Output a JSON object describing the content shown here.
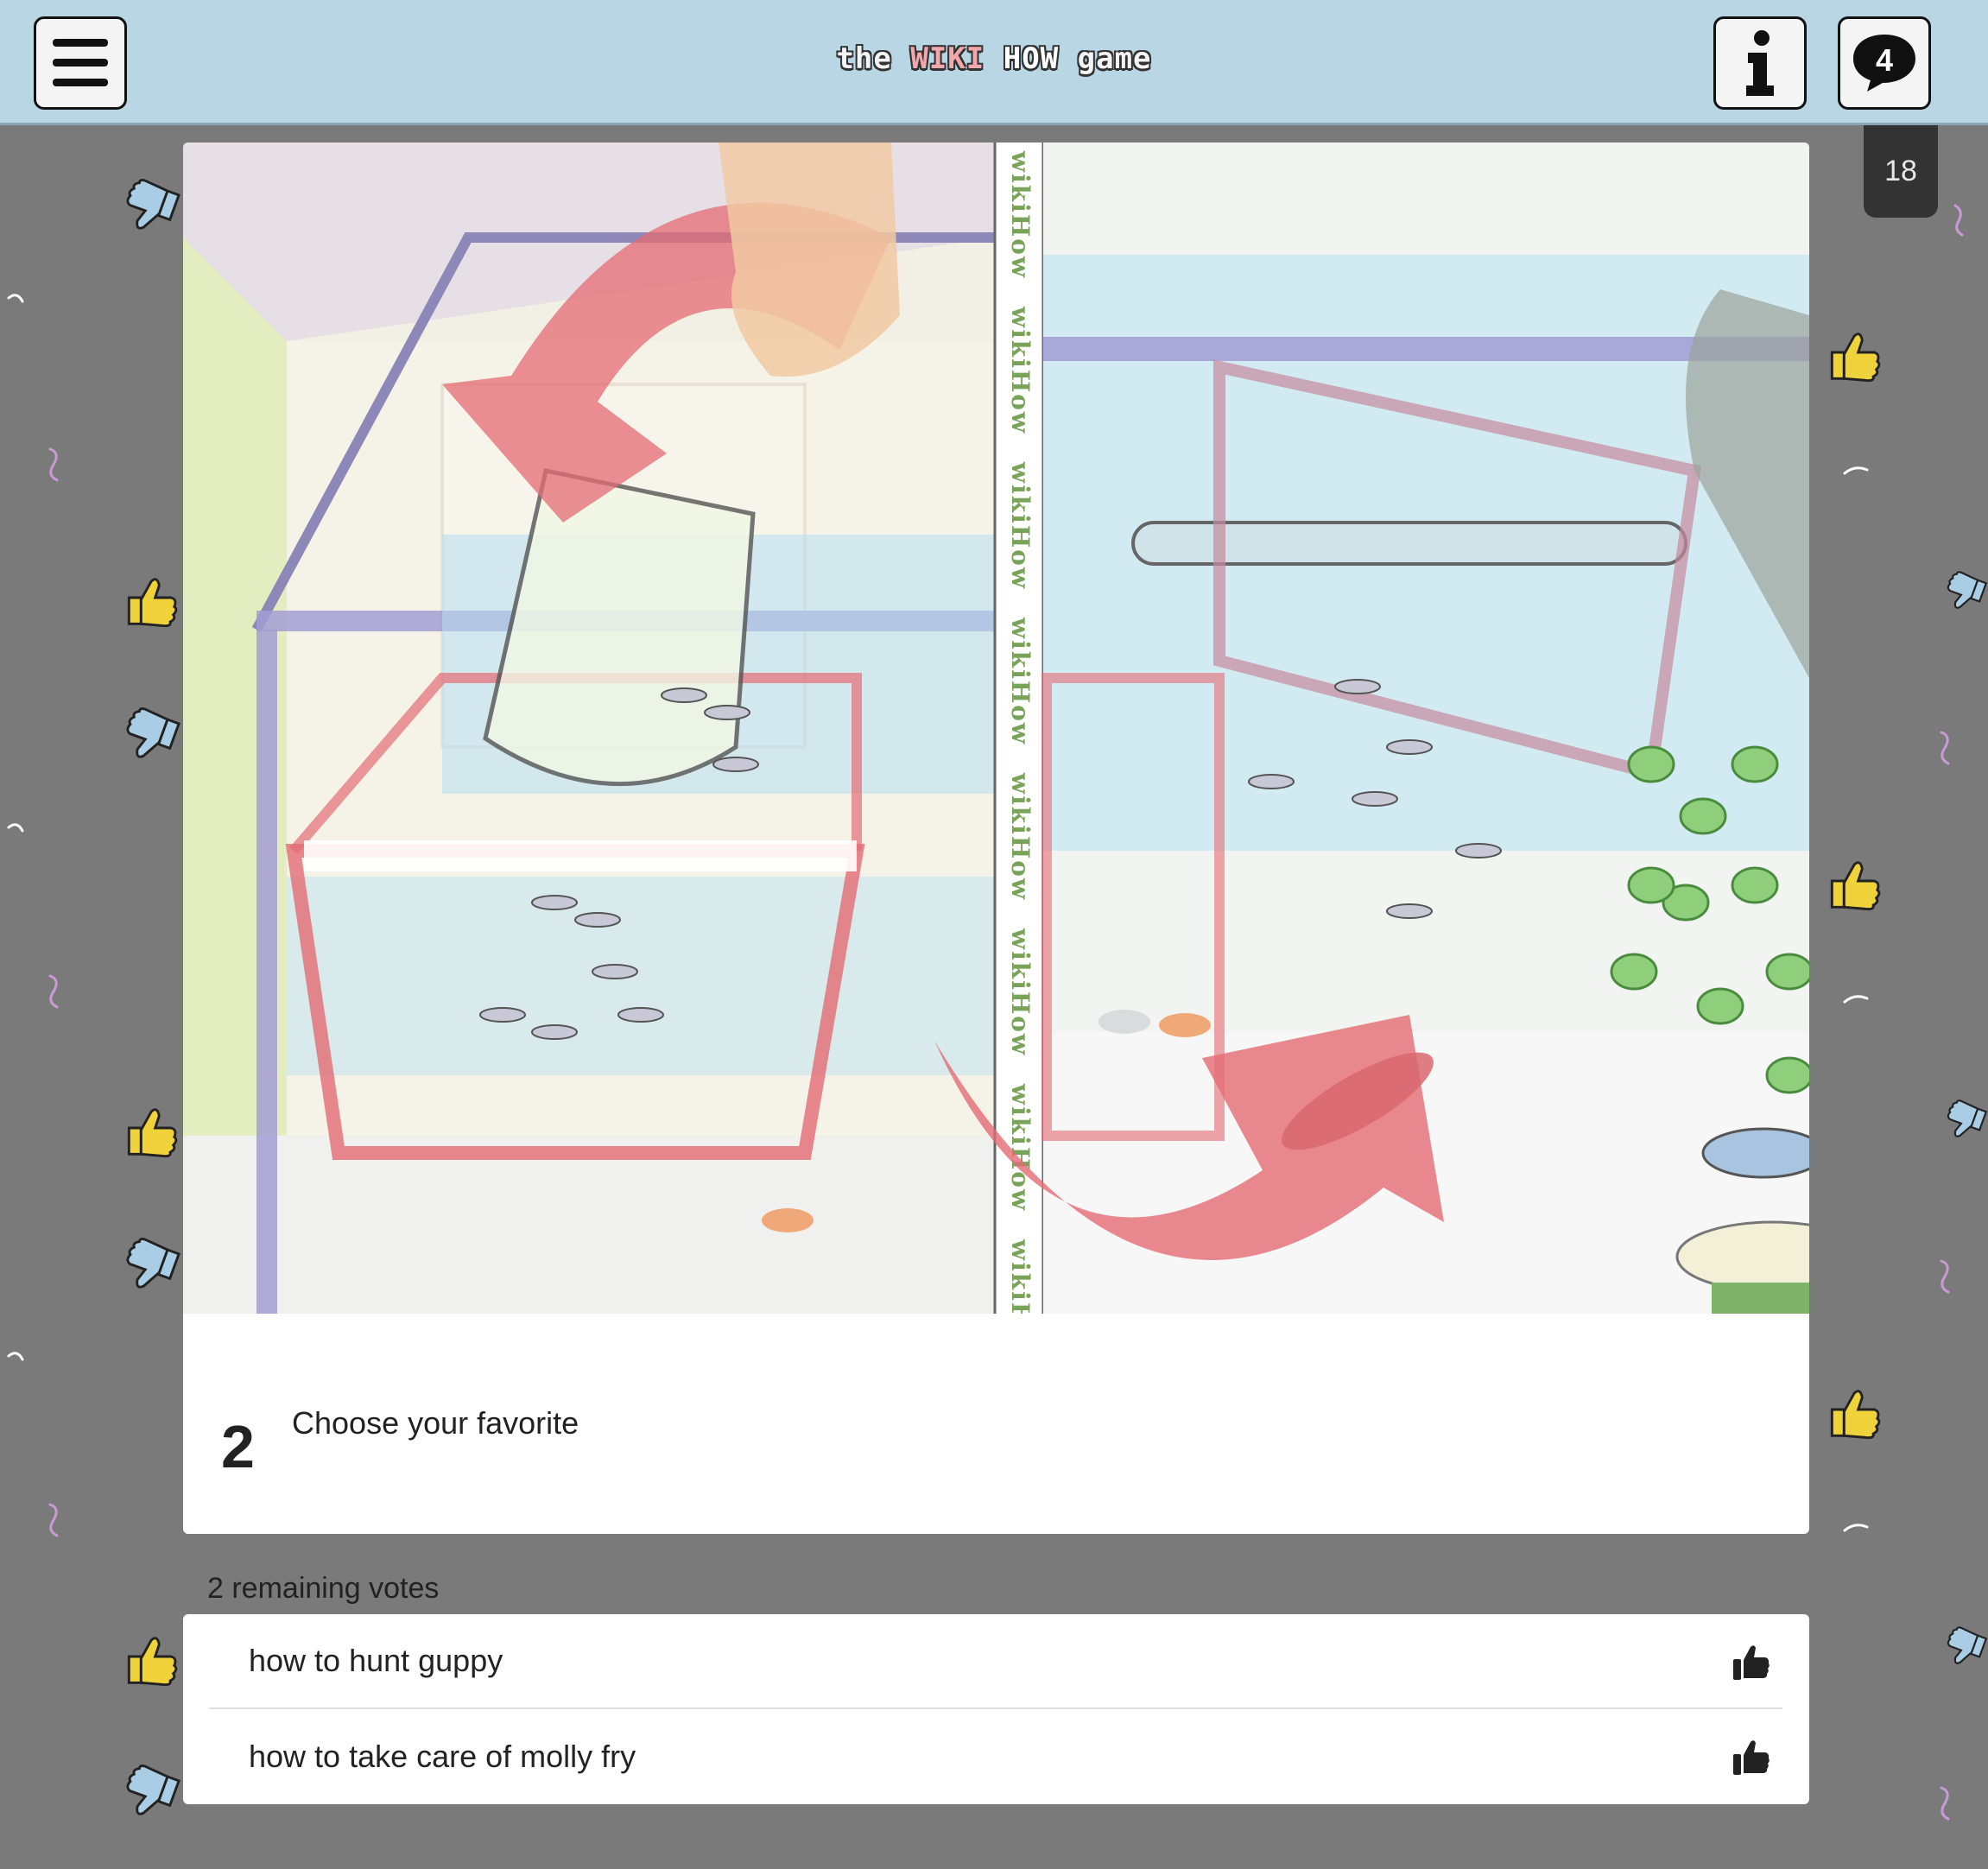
{
  "header": {
    "logo_the": "the",
    "logo_wiki": "WIKI",
    "logo_how": "HOW",
    "logo_game": "game",
    "menu_icon": "hamburger-menu-icon",
    "info_icon": "info-icon",
    "chat_icon": "chat-bubble-icon",
    "chat_count": "4"
  },
  "timer": {
    "value": "18"
  },
  "card": {
    "image_watermark": "wikiHow",
    "step_number": "2",
    "step_text": "Choose your favorite"
  },
  "votes": {
    "remaining_text": "2 remaining votes",
    "options": [
      {
        "label": "how to hunt guppy",
        "icon": "thumbs-up-icon"
      },
      {
        "label": "how to take care of molly fry",
        "icon": "thumbs-up-icon"
      }
    ]
  },
  "colors": {
    "header_bg": "#b8d6e4",
    "page_bg": "#7a7a7a",
    "badge_bg": "#333333",
    "thumb_yellow": "#f0d23a",
    "thumb_blue": "#a9cde4"
  }
}
